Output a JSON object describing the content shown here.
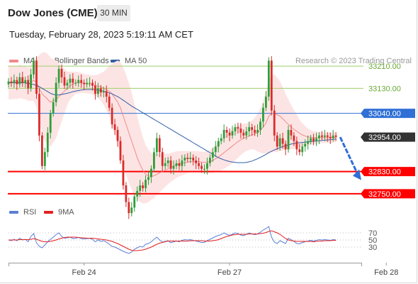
{
  "header": {
    "title": "Dow Jones (CME)",
    "timeframe": "30 MIN",
    "datetime": "Tuesday, February 28, 2023 5:19:11 AM CET"
  },
  "legend": {
    "main": [
      {
        "label": "MA 20 + Bollinger Bands",
        "color": "#f08a8a"
      },
      {
        "label": "MA 50",
        "color": "#2f5fa6"
      }
    ],
    "indicator": [
      {
        "label": "RSI",
        "color": "#5b7fd6"
      },
      {
        "label": "9MA",
        "color": "#e32020"
      }
    ]
  },
  "credit": "Research © 2023 Trading Central",
  "colors": {
    "bull": "#2e9e3a",
    "bear": "#d92b2b",
    "resistance": "#9ecf6a",
    "pivot": "#2f6fd6",
    "support": "#ff0000",
    "last": "#333333",
    "band": "#fde4e4"
  },
  "chart_data": {
    "type": "candlestick",
    "ylim": [
      32660,
      33300
    ],
    "last_price": 32954,
    "levels": [
      {
        "value": 33210,
        "label": "33210.00",
        "kind": "resistance"
      },
      {
        "value": 33130,
        "label": "33130.00",
        "kind": "resistance"
      },
      {
        "value": 33040,
        "label": "33040.00",
        "kind": "pivot"
      },
      {
        "value": 32954,
        "label": "32954.00",
        "kind": "last"
      },
      {
        "value": 32830,
        "label": "32830.00",
        "kind": "support"
      },
      {
        "value": 32750,
        "label": "32750.00",
        "kind": "support"
      }
    ],
    "x_ticks": [
      "Feb 24",
      "Feb 27",
      "Feb 28"
    ],
    "x_tick_bars": [
      27,
      79,
      135
    ],
    "close": [
      33155,
      33150,
      33160,
      33145,
      33170,
      33150,
      33160,
      33130,
      33180,
      33230,
      33110,
      32960,
      32850,
      32900,
      32970,
      33040,
      33080,
      33150,
      33200,
      33170,
      33140,
      33150,
      33165,
      33150,
      33150,
      33160,
      33150,
      33145,
      33150,
      33150,
      33140,
      33110,
      33130,
      33115,
      33120,
      33100,
      33060,
      33000,
      32980,
      32940,
      32870,
      32780,
      32720,
      32680,
      32700,
      32740,
      32760,
      32780,
      32770,
      32800,
      32810,
      32840,
      32900,
      32950,
      32900,
      32850,
      32860,
      32870,
      32840,
      32850,
      32860,
      32850,
      32870,
      32880,
      32875,
      32880,
      32870,
      32860,
      32850,
      32840,
      32840,
      32860,
      32880,
      32900,
      32920,
      32940,
      32950,
      32980,
      32970,
      32960,
      32975,
      32990,
      32985,
      32970,
      32960,
      32975,
      32990,
      32980,
      32970,
      32980,
      33010,
      33060,
      33100,
      33230,
      33050,
      32960,
      32920,
      32950,
      32930,
      32910,
      32980,
      32960,
      32940,
      32910,
      32900,
      32920,
      32930,
      32940,
      32950,
      32940,
      32950,
      32960,
      32955,
      32960,
      32955,
      32950,
      32960,
      32955
    ],
    "bb_mid": [
      33150,
      33150,
      33152,
      33150,
      33155,
      33152,
      33150,
      33145,
      33150,
      33160,
      33150,
      33130,
      33110,
      33100,
      33090,
      33080,
      33085,
      33090,
      33100,
      33110,
      33120,
      33130,
      33140,
      33145,
      33150,
      33150,
      33150,
      33148,
      33146,
      33145,
      33142,
      33140,
      33138,
      33135,
      33130,
      33125,
      33120,
      33110,
      33095,
      33080,
      33060,
      33030,
      33000,
      32970,
      32940,
      32910,
      32880,
      32855,
      32835,
      32820,
      32815,
      32812,
      32815,
      32820,
      32825,
      32830,
      32835,
      32840,
      32845,
      32850,
      32855,
      32858,
      32860,
      32862,
      32864,
      32866,
      32866,
      32866,
      32865,
      32864,
      32863,
      32864,
      32866,
      32870,
      32876,
      32882,
      32890,
      32898,
      32906,
      32914,
      32922,
      32930,
      32938,
      32944,
      32950,
      32954,
      32958,
      32962,
      32966,
      32970,
      32978,
      32990,
      33005,
      33030,
      33040,
      33040,
      33035,
      33030,
      33020,
      33010,
      33000,
      32990,
      32982,
      32975,
      32968,
      32962,
      32958,
      32955,
      32953,
      32952,
      32952,
      32952,
      32952,
      32952,
      32952,
      32952,
      32953,
      32953
    ],
    "bb_width": [
      60,
      60,
      60,
      60,
      60,
      60,
      60,
      60,
      65,
      75,
      90,
      120,
      150,
      160,
      165,
      160,
      150,
      140,
      120,
      100,
      80,
      60,
      50,
      45,
      40,
      38,
      36,
      34,
      34,
      34,
      35,
      38,
      42,
      50,
      60,
      75,
      90,
      110,
      130,
      150,
      165,
      175,
      180,
      180,
      175,
      165,
      150,
      135,
      120,
      105,
      95,
      85,
      80,
      75,
      70,
      65,
      60,
      55,
      52,
      50,
      48,
      46,
      44,
      42,
      40,
      38,
      38,
      38,
      38,
      38,
      38,
      40,
      42,
      45,
      48,
      52,
      55,
      58,
      60,
      62,
      62,
      60,
      58,
      55,
      52,
      50,
      50,
      52,
      58,
      68,
      80,
      95,
      110,
      130,
      140,
      140,
      135,
      125,
      115,
      100,
      90,
      80,
      70,
      60,
      50,
      42,
      36,
      30,
      26,
      24,
      22,
      20,
      20,
      18,
      18,
      18,
      18,
      18
    ],
    "ma50": [
      33150,
      33150,
      33150,
      33150,
      33150,
      33150,
      33150,
      33148,
      33146,
      33144,
      33140,
      33136,
      33130,
      33124,
      33118,
      33112,
      33108,
      33106,
      33106,
      33108,
      33110,
      33112,
      33115,
      33118,
      33120,
      33122,
      33124,
      33125,
      33126,
      33126,
      33126,
      33125,
      33124,
      33122,
      33120,
      33117,
      33114,
      33110,
      33105,
      33100,
      33094,
      33087,
      33080,
      33073,
      33066,
      33060,
      33054,
      33048,
      33042,
      33036,
      33030,
      33024,
      33018,
      33012,
      33006,
      33000,
      32994,
      32988,
      32982,
      32976,
      32970,
      32964,
      32958,
      32952,
      32946,
      32940,
      32934,
      32928,
      32922,
      32916,
      32910,
      32904,
      32898,
      32892,
      32886,
      32880,
      32876,
      32872,
      32869,
      32866,
      32864,
      32863,
      32862,
      32862,
      32862,
      32863,
      32865,
      32868,
      32872,
      32876,
      32881,
      32886,
      32892,
      32898,
      32903,
      32908,
      32912,
      32916,
      32920,
      32923,
      32926,
      32929,
      32931,
      32933,
      32934,
      32935,
      32936,
      32937,
      32938,
      32939,
      32940,
      32941,
      32942,
      32943,
      32944,
      32945,
      32946,
      32947
    ],
    "indicator": {
      "name": "RSI",
      "ylim": [
        0,
        100
      ],
      "levels": [
        70,
        50,
        30
      ],
      "rsi": [
        50,
        48,
        52,
        48,
        55,
        50,
        52,
        45,
        60,
        68,
        42,
        32,
        28,
        36,
        45,
        52,
        58,
        65,
        70,
        60,
        55,
        56,
        58,
        54,
        55,
        57,
        54,
        53,
        54,
        55,
        52,
        45,
        50,
        46,
        48,
        44,
        38,
        32,
        30,
        26,
        22,
        18,
        15,
        12,
        16,
        24,
        28,
        32,
        30,
        38,
        40,
        45,
        52,
        58,
        50,
        44,
        46,
        48,
        42,
        45,
        47,
        45,
        49,
        51,
        50,
        51,
        49,
        47,
        45,
        43,
        43,
        48,
        52,
        56,
        60,
        63,
        65,
        70,
        66,
        63,
        66,
        70,
        68,
        64,
        62,
        66,
        70,
        67,
        65,
        67,
        72,
        78,
        82,
        88,
        58,
        44,
        40,
        48,
        44,
        40,
        55,
        51,
        46,
        40,
        39,
        43,
        45,
        47,
        49,
        47,
        49,
        51,
        50,
        51,
        50,
        49,
        51,
        50
      ],
      "ma9": [
        50,
        50,
        50,
        50,
        51,
        51,
        51,
        51,
        52,
        54,
        52,
        49,
        46,
        45,
        45,
        46,
        48,
        50,
        53,
        55,
        57,
        58,
        58,
        58,
        58,
        57,
        56,
        56,
        55,
        55,
        55,
        54,
        53,
        52,
        51,
        50,
        48,
        46,
        43,
        40,
        36,
        32,
        28,
        24,
        21,
        20,
        20,
        21,
        22,
        24,
        27,
        30,
        34,
        38,
        41,
        43,
        45,
        47,
        47,
        47,
        47,
        47,
        47,
        47,
        47,
        48,
        48,
        48,
        48,
        48,
        47,
        47,
        47,
        48,
        49,
        51,
        54,
        57,
        60,
        62,
        64,
        65,
        66,
        66,
        66,
        66,
        67,
        67,
        67,
        67,
        68,
        69,
        71,
        74,
        76,
        73,
        70,
        66,
        60,
        54,
        50,
        48,
        47,
        46,
        46,
        46,
        46,
        46,
        46,
        45,
        46,
        47,
        47,
        48,
        48,
        48,
        49,
        49
      ]
    }
  }
}
